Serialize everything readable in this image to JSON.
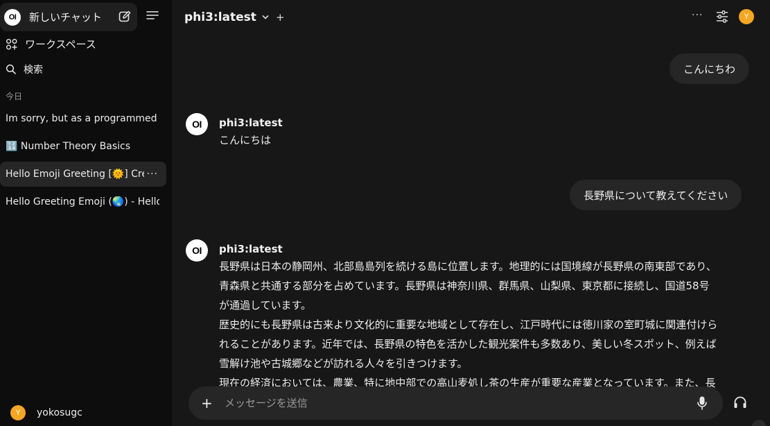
{
  "sidebar": {
    "logo_text": "OI",
    "new_chat_label": "新しいチャット",
    "workspace_label": "ワークスペース",
    "search_label": "検索",
    "section_today": "今日",
    "chats": [
      {
        "title": "Im sorry, but as a programmed te"
      },
      {
        "title": "🔢 Number Theory Basics"
      },
      {
        "title": "Hello Emoji Greeting [🌞] Cre"
      },
      {
        "title": "Hello Greeting Emoji (🌏) - Hello '"
      }
    ],
    "more_label": "···",
    "user": {
      "initial": "Y",
      "name": "yokosugc"
    }
  },
  "header": {
    "model": "phi3:latest",
    "add_label": "+",
    "dots_label": "···",
    "avatar_initial": "Y"
  },
  "messages": {
    "user1": "こんにちわ",
    "bot1_name": "phi3:latest",
    "bot1_text": "こんにちは",
    "user2": "長野県について教えてください",
    "bot2_name": "phi3:latest",
    "bot2_lines": [
      "長野県は日本の静岡州、北部島島列を続ける島に位置します。地理的には国境線が長野県の南東部であり、",
      "青森県と共通する部分を占めています。長野県は神奈川県、群馬県、山梨県、東京都に接続し、国道58号",
      "が通過しています。",
      "歴史的にも長野県は古来より文化的に重要な地域として存在し、江戸時代には徳川家の室町城に関連付けら",
      "れることがあります。近年では、長野県の特色を活かした観光案件も多数あり、美しい冬スポット、例えば",
      "雪解け池や古城郷などが訪れる人々を引きつけます。",
      "現在の経済においては、農業、特に地中部での高山麦処し茶の生産が重要な産業となっています。また、長"
    ]
  },
  "composer": {
    "add_label": "+",
    "placeholder": "メッセージを送信"
  }
}
